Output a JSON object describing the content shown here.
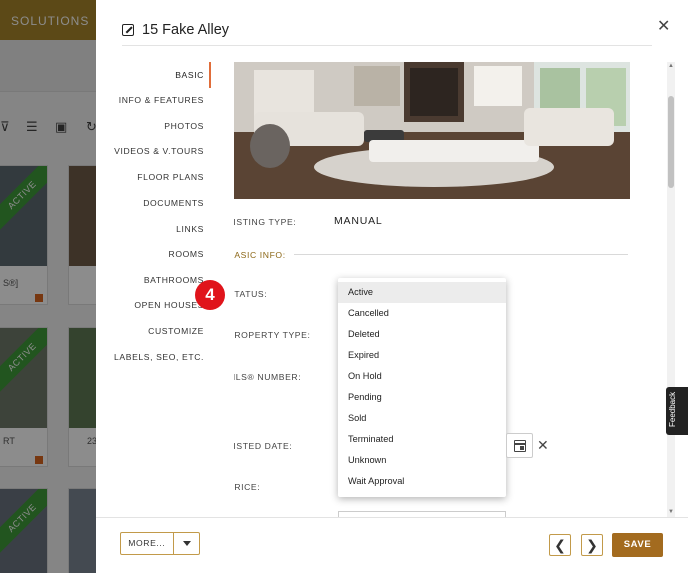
{
  "background": {
    "brand_label": "SOLUTIONS",
    "cards": [
      {
        "badge": "ACTIVE",
        "caption": "S®]"
      },
      {
        "badge": "ACTIVE",
        "caption": "RT"
      },
      {
        "badge": "",
        "caption": "23"
      },
      {
        "badge": "ACTIVE",
        "caption": ""
      }
    ]
  },
  "modal": {
    "title": "15 Fake Alley",
    "nav": [
      {
        "label": "BASIC"
      },
      {
        "label": "INFO & FEATURES"
      },
      {
        "label": "PHOTOS"
      },
      {
        "label": "VIDEOS & V.TOURS"
      },
      {
        "label": "FLOOR PLANS"
      },
      {
        "label": "DOCUMENTS"
      },
      {
        "label": "LINKS"
      },
      {
        "label": "ROOMS"
      },
      {
        "label": "BATHROOMS"
      },
      {
        "label": "OPEN HOUSES"
      },
      {
        "label": "CUSTOMIZE"
      },
      {
        "label": "LABELS, SEO, ETC."
      }
    ],
    "fields": {
      "listing_type_label": "LISTING TYPE:",
      "listing_type_value": "MANUAL",
      "basic_info_heading": "BASIC INFO:",
      "status_label": "STATUS:",
      "property_type_label": "PROPERTY TYPE:",
      "mls_label": "MLS® NUMBER:",
      "listed_date_label": "LISTED DATE:",
      "price_label": "PRICE:"
    },
    "status_options": [
      "Active",
      "Cancelled",
      "Deleted",
      "Expired",
      "On Hold",
      "Pending",
      "Sold",
      "Terminated",
      "Unknown",
      "Wait Approval"
    ],
    "status_selected": "Active",
    "step_badge": "4",
    "feedback_label": "Feedback"
  },
  "footer": {
    "more_label": "MORE...",
    "prev_label": "❮",
    "next_label": "❯",
    "save_label": "SAVE"
  },
  "colors": {
    "accent": "#a36b1f",
    "nav_active_bar": "#e06d3a",
    "badge": "#e0141b",
    "active_ribbon": "#3f9b3a"
  }
}
